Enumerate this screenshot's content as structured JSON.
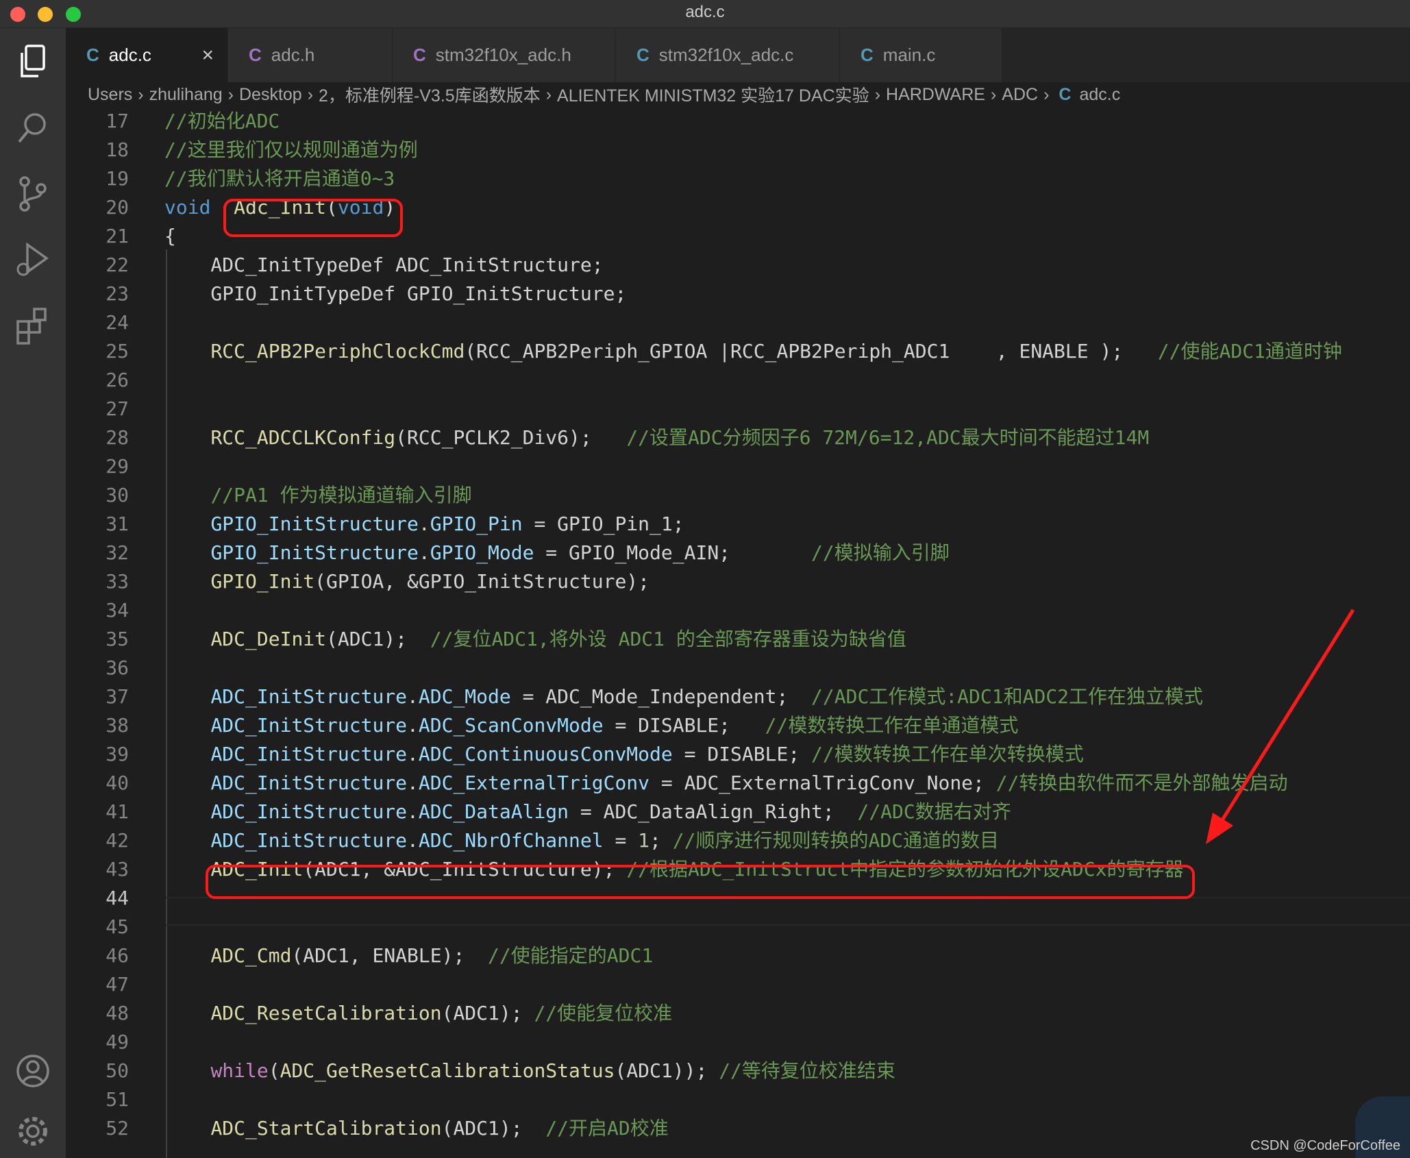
{
  "window": {
    "title": "adc.c"
  },
  "activity": {
    "items": [
      "explorer-icon",
      "search-icon",
      "source-control-icon",
      "run-debug-icon",
      "extensions-icon"
    ],
    "bottom": [
      "account-icon",
      "settings-gear-icon"
    ]
  },
  "tabs": [
    {
      "label": "adc.c",
      "icon": "C",
      "active": true,
      "close": "×"
    },
    {
      "label": "adc.h",
      "icon": "C",
      "active": false
    },
    {
      "label": "stm32f10x_adc.h",
      "icon": "C",
      "active": false
    },
    {
      "label": "stm32f10x_adc.c",
      "icon": "C",
      "active": false
    },
    {
      "label": "main.c",
      "icon": "C",
      "active": false
    }
  ],
  "breadcrumb": {
    "parts": [
      "Users",
      "zhulihang",
      "Desktop",
      "2，标准例程-V3.5库函数版本",
      "ALIENTEK MINISTM32 实验17 DAC实验",
      "HARDWARE",
      "ADC"
    ],
    "file_icon": "C",
    "file": "adc.c",
    "sep": "›"
  },
  "lines": [
    {
      "n": "17",
      "tokens": [
        [
          "cm",
          "//初始化ADC"
        ]
      ]
    },
    {
      "n": "18",
      "tokens": [
        [
          "cm",
          "//这里我们仅以规则通道为例"
        ]
      ]
    },
    {
      "n": "19",
      "tokens": [
        [
          "cm",
          "//我们默认将开启通道0~3"
        ]
      ]
    },
    {
      "n": "20",
      "tokens": [
        [
          "kw",
          "void"
        ],
        [
          "txt",
          "  "
        ],
        [
          "fn",
          "Adc_Init"
        ],
        [
          "txt",
          "("
        ],
        [
          "kw",
          "void"
        ],
        [
          "txt",
          ")"
        ]
      ]
    },
    {
      "n": "21",
      "tokens": [
        [
          "txt",
          "{"
        ]
      ]
    },
    {
      "n": "22",
      "tokens": [
        [
          "txt",
          "    ADC_InitTypeDef ADC_InitStructure;"
        ]
      ]
    },
    {
      "n": "23",
      "tokens": [
        [
          "txt",
          "    GPIO_InitTypeDef GPIO_InitStructure;"
        ]
      ]
    },
    {
      "n": "24",
      "tokens": []
    },
    {
      "n": "25",
      "tokens": [
        [
          "txt",
          "    "
        ],
        [
          "fn",
          "RCC_APB2PeriphClockCmd"
        ],
        [
          "txt",
          "(RCC_APB2Periph_GPIOA |RCC_APB2Periph_ADC1    , ENABLE );   "
        ],
        [
          "cm",
          "//使能ADC1通道时钟"
        ]
      ]
    },
    {
      "n": "26",
      "tokens": []
    },
    {
      "n": "27",
      "tokens": []
    },
    {
      "n": "28",
      "tokens": [
        [
          "txt",
          "    "
        ],
        [
          "fn",
          "RCC_ADCCLKConfig"
        ],
        [
          "txt",
          "(RCC_PCLK2_Div6);   "
        ],
        [
          "cm",
          "//设置ADC分频因子6 72M/6=12,ADC最大时间不能超过14M"
        ]
      ]
    },
    {
      "n": "29",
      "tokens": []
    },
    {
      "n": "30",
      "tokens": [
        [
          "txt",
          "    "
        ],
        [
          "cm",
          "//PA1 作为模拟通道输入引脚"
        ]
      ]
    },
    {
      "n": "31",
      "tokens": [
        [
          "txt",
          "    "
        ],
        [
          "var",
          "GPIO_InitStructure"
        ],
        [
          "txt",
          "."
        ],
        [
          "var",
          "GPIO_Pin"
        ],
        [
          "txt",
          " = GPIO_Pin_1;"
        ]
      ]
    },
    {
      "n": "32",
      "tokens": [
        [
          "txt",
          "    "
        ],
        [
          "var",
          "GPIO_InitStructure"
        ],
        [
          "txt",
          "."
        ],
        [
          "var",
          "GPIO_Mode"
        ],
        [
          "txt",
          " = GPIO_Mode_AIN;       "
        ],
        [
          "cm",
          "//模拟输入引脚"
        ]
      ]
    },
    {
      "n": "33",
      "tokens": [
        [
          "txt",
          "    "
        ],
        [
          "fn",
          "GPIO_Init"
        ],
        [
          "txt",
          "(GPIOA, &GPIO_InitStructure);"
        ]
      ]
    },
    {
      "n": "34",
      "tokens": []
    },
    {
      "n": "35",
      "tokens": [
        [
          "txt",
          "    "
        ],
        [
          "fn",
          "ADC_DeInit"
        ],
        [
          "txt",
          "(ADC1);  "
        ],
        [
          "cm",
          "//复位ADC1,将外设 ADC1 的全部寄存器重设为缺省值"
        ]
      ]
    },
    {
      "n": "36",
      "tokens": []
    },
    {
      "n": "37",
      "tokens": [
        [
          "txt",
          "    "
        ],
        [
          "var",
          "ADC_InitStructure"
        ],
        [
          "txt",
          "."
        ],
        [
          "var",
          "ADC_Mode"
        ],
        [
          "txt",
          " = ADC_Mode_Independent;  "
        ],
        [
          "cm",
          "//ADC工作模式:ADC1和ADC2工作在独立模式"
        ]
      ]
    },
    {
      "n": "38",
      "tokens": [
        [
          "txt",
          "    "
        ],
        [
          "var",
          "ADC_InitStructure"
        ],
        [
          "txt",
          "."
        ],
        [
          "var",
          "ADC_ScanConvMode"
        ],
        [
          "txt",
          " = DISABLE;   "
        ],
        [
          "cm",
          "//模数转换工作在单通道模式"
        ]
      ]
    },
    {
      "n": "39",
      "tokens": [
        [
          "txt",
          "    "
        ],
        [
          "var",
          "ADC_InitStructure"
        ],
        [
          "txt",
          "."
        ],
        [
          "var",
          "ADC_ContinuousConvMode"
        ],
        [
          "txt",
          " = DISABLE; "
        ],
        [
          "cm",
          "//模数转换工作在单次转换模式"
        ]
      ]
    },
    {
      "n": "40",
      "tokens": [
        [
          "txt",
          "    "
        ],
        [
          "var",
          "ADC_InitStructure"
        ],
        [
          "txt",
          "."
        ],
        [
          "var",
          "ADC_ExternalTrigConv"
        ],
        [
          "txt",
          " = ADC_ExternalTrigConv_None; "
        ],
        [
          "cm",
          "//转换由软件而不是外部触发启动"
        ]
      ]
    },
    {
      "n": "41",
      "tokens": [
        [
          "txt",
          "    "
        ],
        [
          "var",
          "ADC_InitStructure"
        ],
        [
          "txt",
          "."
        ],
        [
          "var",
          "ADC_DataAlign"
        ],
        [
          "txt",
          " = ADC_DataAlign_Right;  "
        ],
        [
          "cm",
          "//ADC数据右对齐"
        ]
      ]
    },
    {
      "n": "42",
      "tokens": [
        [
          "txt",
          "    "
        ],
        [
          "var",
          "ADC_InitStructure"
        ],
        [
          "txt",
          "."
        ],
        [
          "var",
          "ADC_NbrOfChannel"
        ],
        [
          "txt",
          " = "
        ],
        [
          "num",
          "1"
        ],
        [
          "txt",
          "; "
        ],
        [
          "cm",
          "//顺序进行规则转换的ADC通道的数目"
        ]
      ]
    },
    {
      "n": "43",
      "tokens": [
        [
          "txt",
          "    "
        ],
        [
          "fn",
          "ADC_Init"
        ],
        [
          "txt",
          "(ADC1, &ADC_InitStructure); "
        ],
        [
          "cm",
          "//根据ADC_InitStruct中指定的参数初始化外设ADCx的寄存器"
        ]
      ]
    },
    {
      "n": "44",
      "tokens": [],
      "current": true
    },
    {
      "n": "45",
      "tokens": []
    },
    {
      "n": "46",
      "tokens": [
        [
          "txt",
          "    "
        ],
        [
          "fn",
          "ADC_Cmd"
        ],
        [
          "txt",
          "(ADC1, ENABLE);  "
        ],
        [
          "cm",
          "//使能指定的ADC1"
        ]
      ]
    },
    {
      "n": "47",
      "tokens": []
    },
    {
      "n": "48",
      "tokens": [
        [
          "txt",
          "    "
        ],
        [
          "fn",
          "ADC_ResetCalibration"
        ],
        [
          "txt",
          "(ADC1); "
        ],
        [
          "cm",
          "//使能复位校准"
        ]
      ]
    },
    {
      "n": "49",
      "tokens": []
    },
    {
      "n": "50",
      "tokens": [
        [
          "txt",
          "    "
        ],
        [
          "ctl",
          "while"
        ],
        [
          "txt",
          "("
        ],
        [
          "fn",
          "ADC_GetResetCalibrationStatus"
        ],
        [
          "txt",
          "(ADC1)); "
        ],
        [
          "cm",
          "//等待复位校准结束"
        ]
      ]
    },
    {
      "n": "51",
      "tokens": []
    },
    {
      "n": "52",
      "tokens": [
        [
          "txt",
          "    "
        ],
        [
          "fn",
          "ADC_StartCalibration"
        ],
        [
          "txt",
          "(ADC1);  "
        ],
        [
          "cm",
          "//开启AD校准"
        ]
      ]
    }
  ],
  "annotation_color": "#ff1a1a",
  "watermark": "CSDN @CodeForCoffee"
}
